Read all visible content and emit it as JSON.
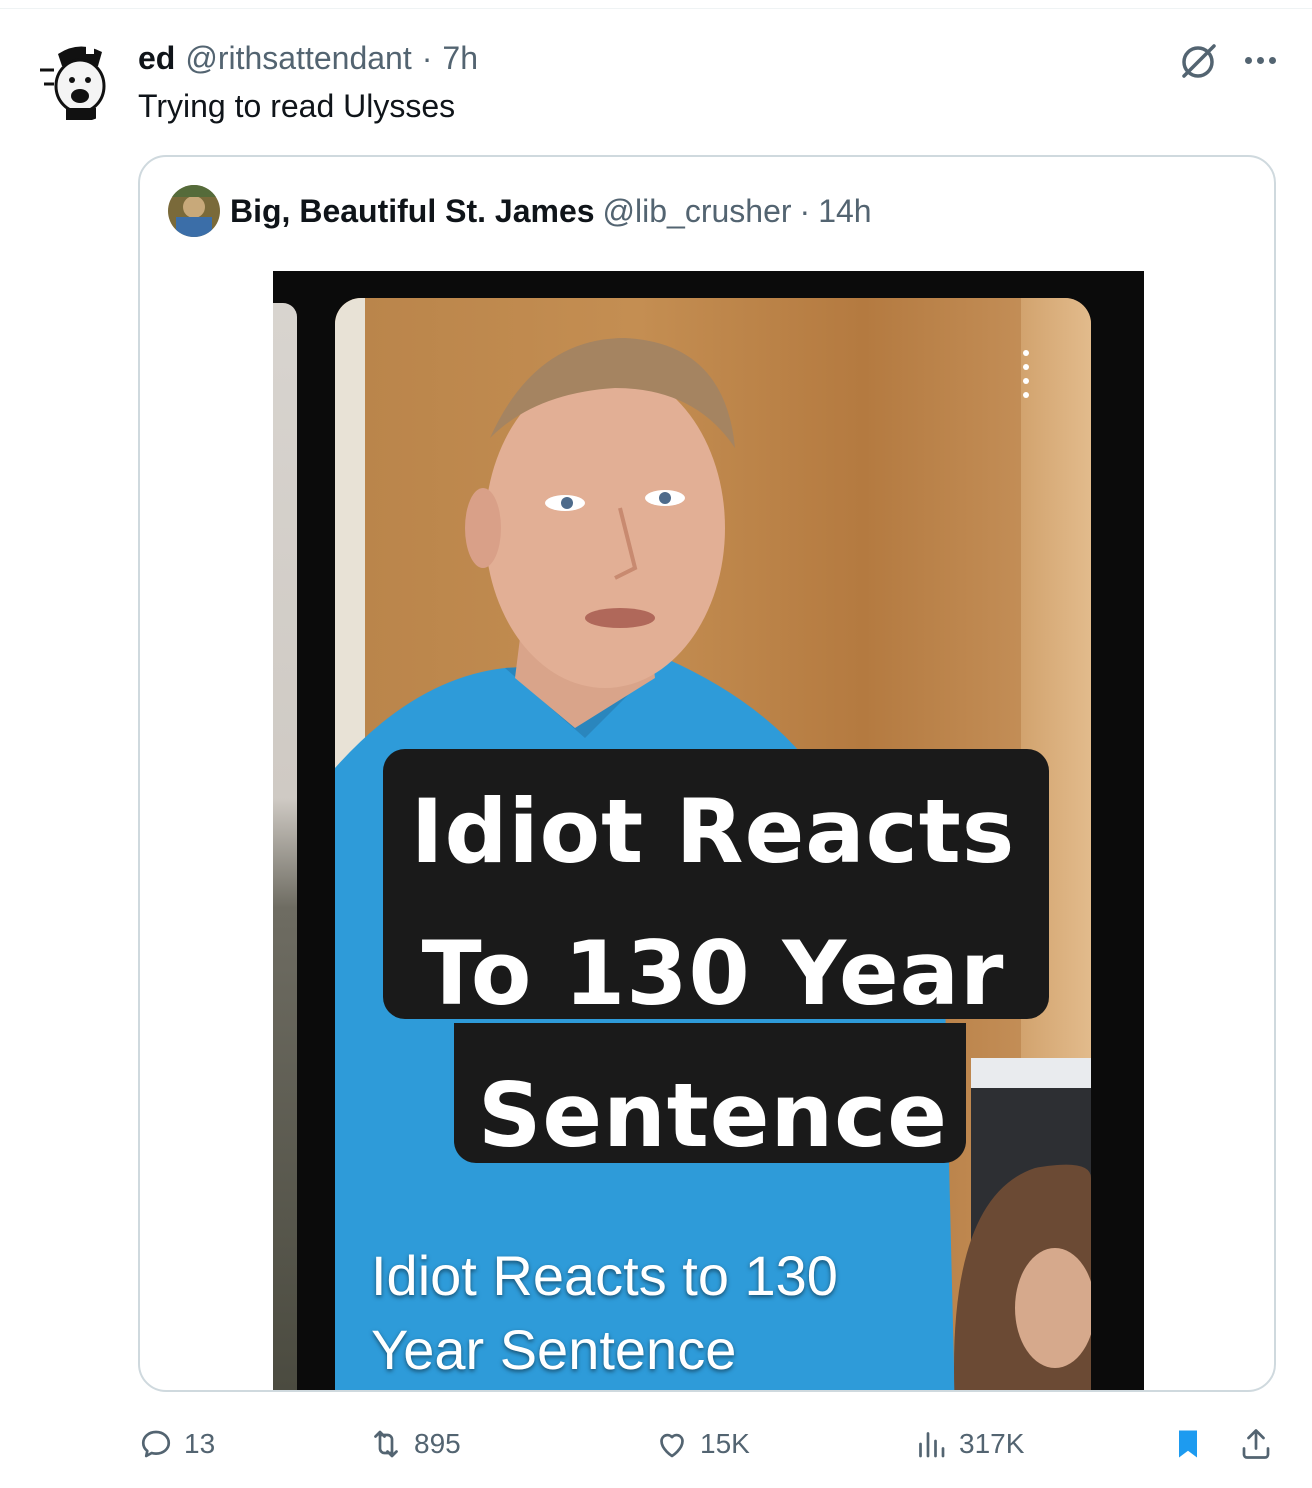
{
  "tweet": {
    "name": "ed",
    "handle": "@rithsattendant",
    "separator": "·",
    "time": "7h",
    "text": "Trying to read Ulysses"
  },
  "quote": {
    "name": "Big, Beautiful St. James",
    "handle": "@lib_crusher",
    "separator": "·",
    "time": "14h",
    "media": {
      "title_lines": [
        "Idiot Reacts",
        "To 130 Year",
        "Sentence"
      ],
      "caption_lines": [
        "Idiot Reacts to 130",
        "Year Sentence"
      ]
    }
  },
  "actions": {
    "replies": "13",
    "reposts": "895",
    "likes": "15K",
    "views": "317K"
  },
  "colors": {
    "secondary_text": "#536471",
    "bookmark_active": "#1d9bf0",
    "border": "#cfd9de"
  },
  "icons": [
    "grok-icon",
    "more-icon",
    "reply-icon",
    "repost-icon",
    "like-icon",
    "views-icon",
    "bookmark-icon",
    "share-icon"
  ]
}
